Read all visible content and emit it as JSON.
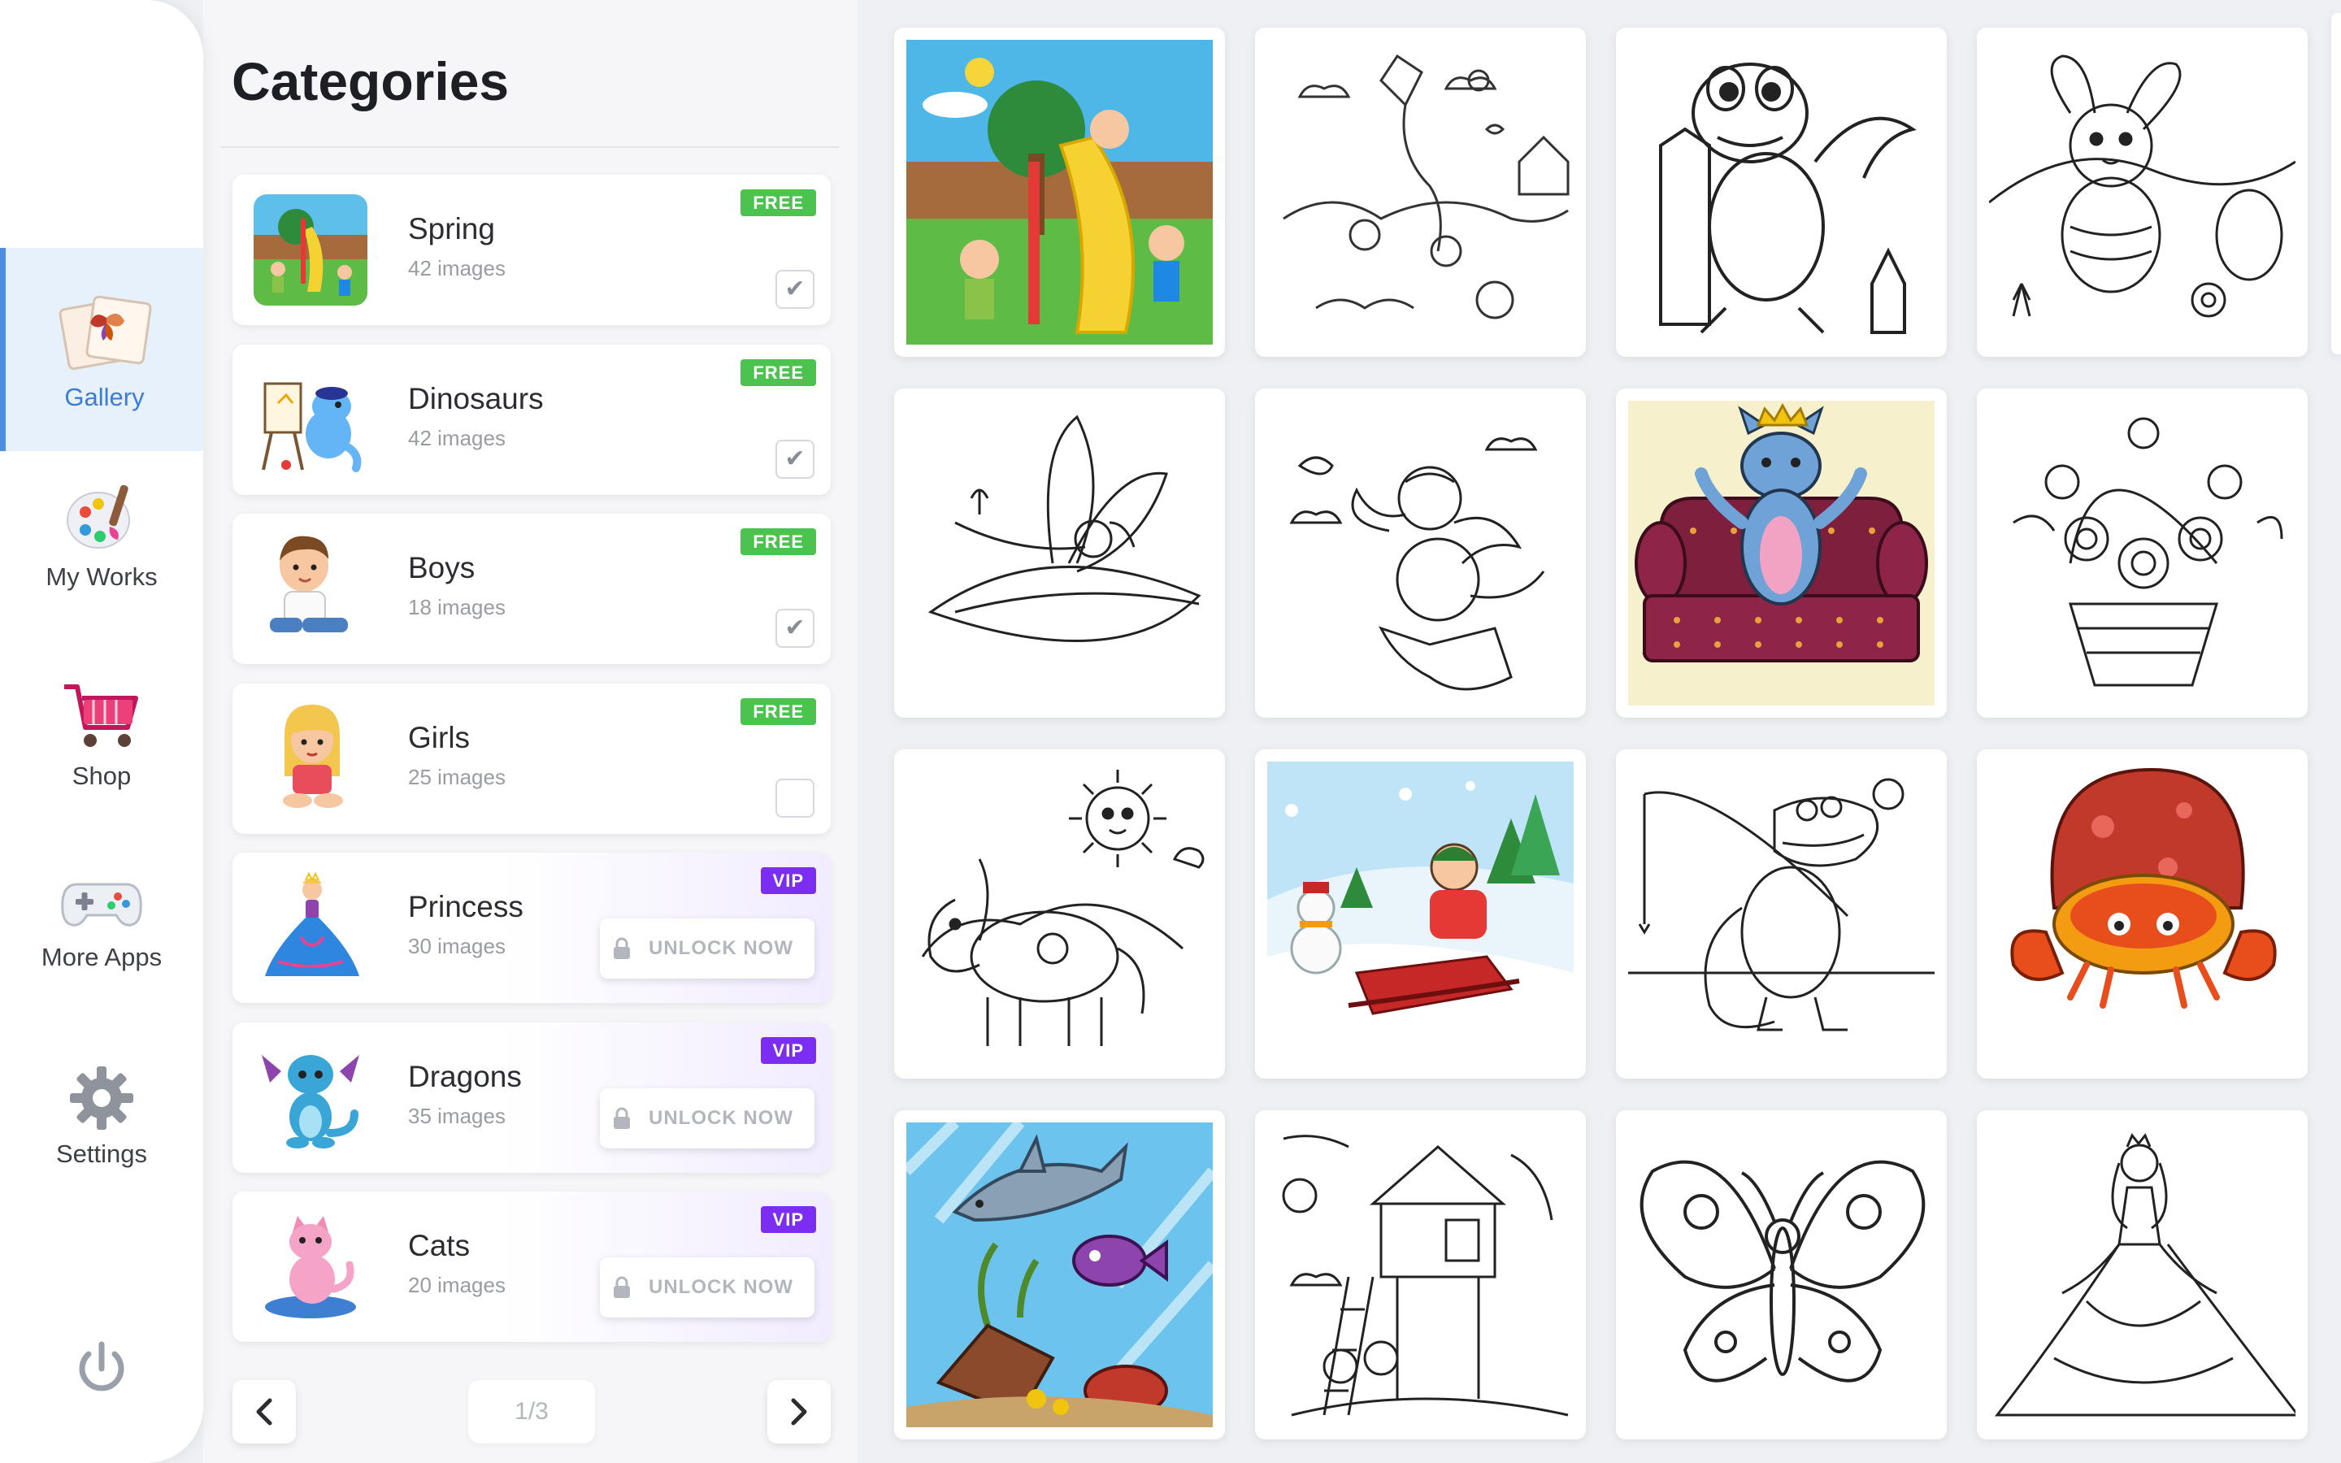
{
  "nav": {
    "items": [
      {
        "label": "Gallery",
        "icon": "gallery-icon",
        "active": true
      },
      {
        "label": "My Works",
        "icon": "palette-icon",
        "active": false
      },
      {
        "label": "Shop",
        "icon": "shopping-cart-icon",
        "active": false
      },
      {
        "label": "More Apps",
        "icon": "gamepad-icon",
        "active": false
      },
      {
        "label": "Settings",
        "icon": "gear-icon",
        "active": false
      }
    ],
    "power_icon": "power-icon",
    "accent_color": "#4b8fe0"
  },
  "categories": {
    "title": "Categories",
    "items": [
      {
        "name": "Spring",
        "count": "42 images",
        "badge": "FREE",
        "status": "checked",
        "thumb_icon": "playground-thumbnail"
      },
      {
        "name": "Dinosaurs",
        "count": "42 images",
        "badge": "FREE",
        "status": "checked",
        "thumb_icon": "dinosaur-painter-thumbnail"
      },
      {
        "name": "Boys",
        "count": "18 images",
        "badge": "FREE",
        "status": "checked",
        "thumb_icon": "boy-thumbnail"
      },
      {
        "name": "Girls",
        "count": "25 images",
        "badge": "FREE",
        "status": "unchecked",
        "thumb_icon": "girl-thumbnail"
      },
      {
        "name": "Princess",
        "count": "30 images",
        "badge": "VIP",
        "status": "locked",
        "thumb_icon": "princess-thumbnail"
      },
      {
        "name": "Dragons",
        "count": "35 images",
        "badge": "VIP",
        "status": "locked",
        "thumb_icon": "dragon-thumbnail"
      },
      {
        "name": "Cats",
        "count": "20 images",
        "badge": "VIP",
        "status": "locked",
        "thumb_icon": "cat-thumbnail"
      }
    ],
    "unlock_label": "UNLOCK NOW",
    "pager": {
      "indicator": "1/3"
    },
    "colors": {
      "free": "#4cc24f",
      "vip": "#7b2df2"
    }
  },
  "gallery": {
    "tiles": [
      {
        "subject": "kids-on-playground-slide",
        "colored": true
      },
      {
        "subject": "kite-and-village-outline",
        "colored": false
      },
      {
        "subject": "dinosaur-with-pencils-outline",
        "colored": false
      },
      {
        "subject": "easter-bunny-with-egg-outline",
        "colored": false
      },
      {
        "subject": "fairy-on-leaf-outline",
        "colored": false
      },
      {
        "subject": "baby-dragon-on-cliff-outline",
        "colored": false
      },
      {
        "subject": "crowned-cat-on-armchair",
        "colored": true
      },
      {
        "subject": "rose-basket-outline",
        "colored": false
      },
      {
        "subject": "pony-with-sun-outline",
        "colored": false
      },
      {
        "subject": "boy-sledding-with-snowman",
        "colored": true
      },
      {
        "subject": "fishing-crocodile-outline",
        "colored": false
      },
      {
        "subject": "crab-in-mushroom-house",
        "colored": true
      },
      {
        "subject": "underwater-shark-and-fish",
        "colored": true
      },
      {
        "subject": "treehouse-outline",
        "colored": false
      },
      {
        "subject": "butterfly-outline",
        "colored": false
      },
      {
        "subject": "princess-in-gown-outline",
        "colored": false
      }
    ]
  }
}
